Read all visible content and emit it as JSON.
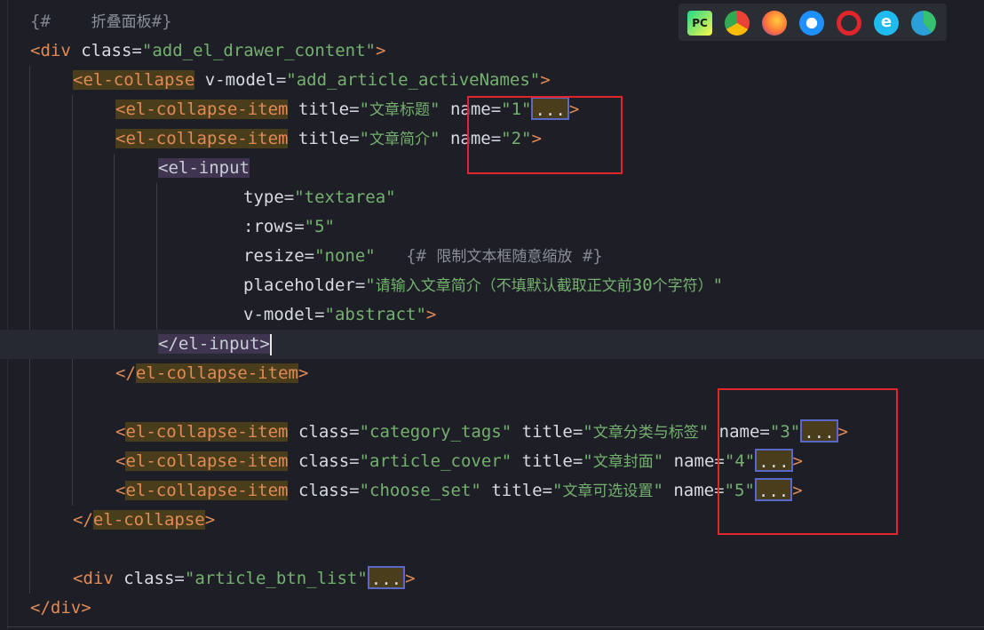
{
  "editor": {
    "lines": [
      {
        "id": "l0",
        "parts": [
          [
            "cmt",
            "{#"
          ],
          [
            "pad",
            "    "
          ],
          [
            "cmt-text",
            "折叠面板"
          ],
          [
            "cmt",
            "#}"
          ]
        ]
      },
      {
        "id": "l1",
        "parts": [
          [
            "tag",
            "<div"
          ],
          [
            "punc",
            " "
          ],
          [
            "attr",
            "class"
          ],
          [
            "punc",
            "="
          ],
          [
            "str",
            "\"add_el_drawer_content\""
          ],
          [
            "tag",
            ">"
          ]
        ]
      },
      {
        "id": "l2",
        "parts": [
          [
            "tag-hl",
            "<el-collapse"
          ],
          [
            "punc",
            " "
          ],
          [
            "attr",
            "v-model"
          ],
          [
            "punc",
            "="
          ],
          [
            "str",
            "\"add_article_activeNames\""
          ],
          [
            "tag",
            ">"
          ]
        ]
      },
      {
        "id": "l3",
        "parts": [
          [
            "tag-hl",
            "<el-collapse-item"
          ],
          [
            "punc",
            " "
          ],
          [
            "attr",
            "title"
          ],
          [
            "punc",
            "="
          ],
          [
            "str",
            "\""
          ],
          [
            "cjk",
            "文章标题"
          ],
          [
            "str",
            "\""
          ],
          [
            "punc",
            " "
          ],
          [
            "attr",
            "name"
          ],
          [
            "punc",
            "="
          ],
          [
            "str",
            "\"1\""
          ],
          [
            "fold",
            "..."
          ],
          [
            "tag",
            ">"
          ]
        ]
      },
      {
        "id": "l4",
        "parts": [
          [
            "tag-hl",
            "<el-collapse-item"
          ],
          [
            "punc",
            " "
          ],
          [
            "attr",
            "title"
          ],
          [
            "punc",
            "="
          ],
          [
            "str",
            "\""
          ],
          [
            "cjk",
            "文章简介"
          ],
          [
            "str",
            "\""
          ],
          [
            "punc",
            " "
          ],
          [
            "attr",
            "name"
          ],
          [
            "punc",
            "="
          ],
          [
            "str",
            "\"2\""
          ],
          [
            "tag",
            ">"
          ]
        ]
      },
      {
        "id": "l5",
        "parts": [
          [
            "tag-bg",
            "<el-input"
          ]
        ]
      },
      {
        "id": "l6",
        "parts": [
          [
            "attr",
            "type"
          ],
          [
            "punc",
            "="
          ],
          [
            "str",
            "\"textarea\""
          ]
        ]
      },
      {
        "id": "l7",
        "parts": [
          [
            "attr",
            ":rows"
          ],
          [
            "punc",
            "="
          ],
          [
            "str",
            "\"5\""
          ]
        ]
      },
      {
        "id": "l8",
        "parts": [
          [
            "attr",
            "resize"
          ],
          [
            "punc",
            "="
          ],
          [
            "str",
            "\"none\""
          ],
          [
            "pad",
            "   "
          ],
          [
            "cmt",
            "{#"
          ],
          [
            "pad",
            " "
          ],
          [
            "cmt-text",
            "限制文本框随意缩放"
          ],
          [
            "pad",
            " "
          ],
          [
            "cmt",
            "#}"
          ]
        ]
      },
      {
        "id": "l9",
        "parts": [
          [
            "attr",
            "placeholder"
          ],
          [
            "punc",
            "="
          ],
          [
            "str",
            "\""
          ],
          [
            "cjk",
            "请输入文章简介（不填默认截取正文前"
          ],
          [
            "str",
            "30"
          ],
          [
            "cjk",
            "个字符）"
          ],
          [
            "str",
            "\""
          ]
        ]
      },
      {
        "id": "l10",
        "parts": [
          [
            "attr",
            "v-model"
          ],
          [
            "punc",
            "="
          ],
          [
            "str",
            "\"abstract\""
          ],
          [
            "tag",
            ">"
          ]
        ]
      },
      {
        "id": "l11",
        "parts": [
          [
            "tag-bg",
            "</el-input>"
          ],
          [
            "cursor",
            ""
          ]
        ]
      },
      {
        "id": "l12",
        "parts": [
          [
            "tag",
            "</"
          ],
          [
            "tag-hl",
            "el-collapse-item"
          ],
          [
            "tag",
            ">"
          ]
        ]
      },
      {
        "id": "l13",
        "parts": []
      },
      {
        "id": "l14",
        "parts": [
          [
            "tag",
            "<"
          ],
          [
            "tag-hl",
            "el-collapse-item"
          ],
          [
            "punc",
            " "
          ],
          [
            "attr",
            "class"
          ],
          [
            "punc",
            "="
          ],
          [
            "str",
            "\"category_tags\""
          ],
          [
            "punc",
            " "
          ],
          [
            "attr",
            "title"
          ],
          [
            "punc",
            "="
          ],
          [
            "str",
            "\""
          ],
          [
            "cjk",
            "文章分类与标签"
          ],
          [
            "str",
            "\""
          ],
          [
            "punc",
            " "
          ],
          [
            "attr",
            "name"
          ],
          [
            "punc",
            "="
          ],
          [
            "str",
            "\"3\""
          ],
          [
            "fold",
            "..."
          ],
          [
            "tag",
            ">"
          ]
        ]
      },
      {
        "id": "l15",
        "parts": [
          [
            "tag",
            "<"
          ],
          [
            "tag-hl",
            "el-collapse-item"
          ],
          [
            "punc",
            " "
          ],
          [
            "attr",
            "class"
          ],
          [
            "punc",
            "="
          ],
          [
            "str",
            "\"article_cover\""
          ],
          [
            "punc",
            " "
          ],
          [
            "attr",
            "title"
          ],
          [
            "punc",
            "="
          ],
          [
            "str",
            "\""
          ],
          [
            "cjk",
            "文章封面"
          ],
          [
            "str",
            "\""
          ],
          [
            "punc",
            " "
          ],
          [
            "attr",
            "name"
          ],
          [
            "punc",
            "="
          ],
          [
            "str",
            "\"4\""
          ],
          [
            "fold",
            "..."
          ],
          [
            "tag",
            ">"
          ]
        ]
      },
      {
        "id": "l16",
        "parts": [
          [
            "tag",
            "<"
          ],
          [
            "tag-hl",
            "el-collapse-item"
          ],
          [
            "punc",
            " "
          ],
          [
            "attr",
            "class"
          ],
          [
            "punc",
            "="
          ],
          [
            "str",
            "\"choose_set\""
          ],
          [
            "punc",
            " "
          ],
          [
            "attr",
            "title"
          ],
          [
            "punc",
            "="
          ],
          [
            "str",
            "\""
          ],
          [
            "cjk",
            "文章可选设置"
          ],
          [
            "str",
            "\""
          ],
          [
            "punc",
            " "
          ],
          [
            "attr",
            "name"
          ],
          [
            "punc",
            "="
          ],
          [
            "str",
            "\"5\""
          ],
          [
            "fold",
            "..."
          ],
          [
            "tag",
            ">"
          ]
        ]
      },
      {
        "id": "l17",
        "parts": [
          [
            "tag",
            "</"
          ],
          [
            "tag-hl",
            "el-collapse"
          ],
          [
            "tag",
            ">"
          ]
        ]
      },
      {
        "id": "l18",
        "parts": []
      },
      {
        "id": "l19",
        "parts": [
          [
            "tag",
            "<div"
          ],
          [
            "punc",
            " "
          ],
          [
            "attr",
            "class"
          ],
          [
            "punc",
            "="
          ],
          [
            "str",
            "\"article_btn_list\""
          ],
          [
            "fold",
            "..."
          ],
          [
            "tag",
            ">"
          ]
        ]
      },
      {
        "id": "l20",
        "parts": [
          [
            "tag",
            "</div>"
          ]
        ]
      }
    ]
  },
  "browser_icons": [
    {
      "name": "pycharm-icon",
      "label": "PC",
      "color": "#21d789"
    },
    {
      "name": "chrome-icon",
      "label": "",
      "color": "#4285f4"
    },
    {
      "name": "firefox-icon",
      "label": "",
      "color": "#ff7139"
    },
    {
      "name": "safari-icon",
      "label": "",
      "color": "#1e90ff"
    },
    {
      "name": "opera-icon",
      "label": "O",
      "color": "#e0252b"
    },
    {
      "name": "ie-icon",
      "label": "e",
      "color": "#1ebbee"
    },
    {
      "name": "edge-icon",
      "label": "",
      "color": "#2b9fd8"
    }
  ]
}
